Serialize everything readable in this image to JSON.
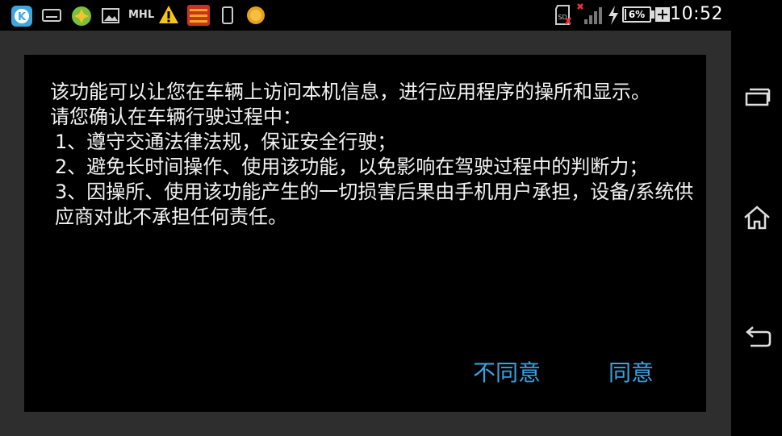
{
  "status_bar": {
    "time": "10:52",
    "battery": "6%",
    "carrier_logo_text": "MHL",
    "left_icons": [
      "k-app-icon",
      "keyboard-icon",
      "puzzle-app-icon",
      "image-icon",
      "mhl-icon",
      "warning-icon",
      "app-badge-icon",
      "phone-icon",
      "orange-dot-icon"
    ],
    "right_icons": [
      "sd-card-icon",
      "no-signal-icon",
      "charging-icon",
      "battery-icon",
      "plus-icon"
    ]
  },
  "dialog": {
    "lines": [
      "该功能可以让您在车辆上访问本机信息，进行应用程序的操所和显示。",
      "请您确认在车辆行驶过程中：",
      "1、遵守交通法律法规，保证安全行驶；",
      "2、避免长时间操作、使用该功能，以免影响在驾驶过程中的判断力；",
      "3、因操所、使用该功能产生的一切损害后果由手机用户承担，设备/系统供应商对此不承担任何责任。"
    ],
    "disagree_label": "不同意",
    "agree_label": "同意"
  },
  "nav_bar": {
    "buttons": [
      "recent-apps-icon",
      "home-icon",
      "back-icon"
    ]
  },
  "colors": {
    "accent": "#3aa2e0",
    "dialog_bg": "#000000",
    "app_bg": "#2e2e2e"
  }
}
